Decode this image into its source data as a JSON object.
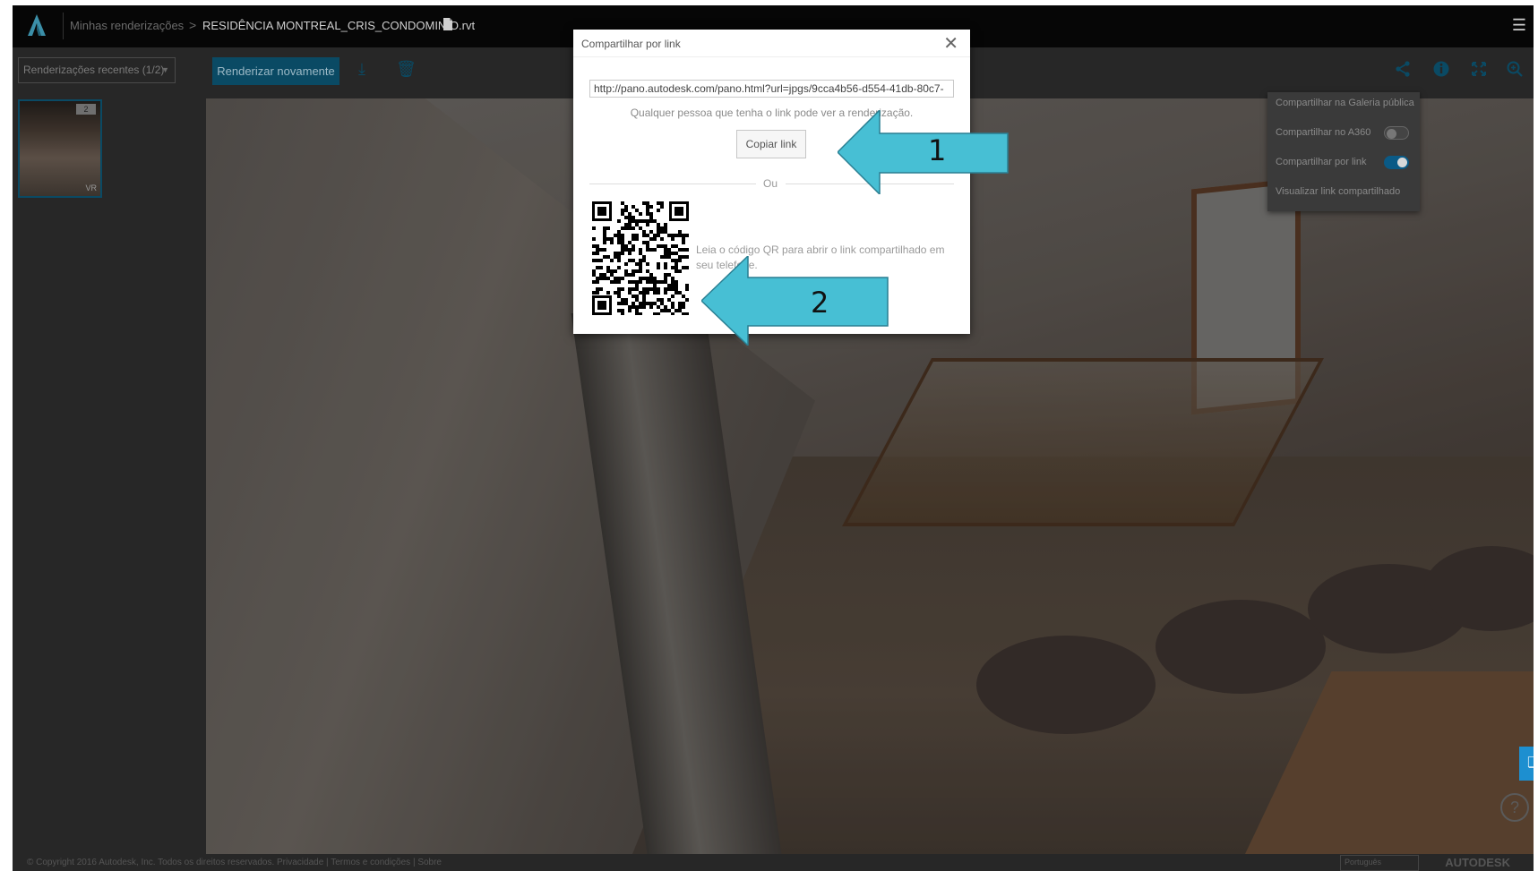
{
  "header": {
    "breadcrumb_root": "Minhas renderizações",
    "breadcrumb_separator": ">",
    "file_name": "RESIDÊNCIA MONTREAL_CRIS_CONDOMINIO.rvt",
    "menu_icon": "hamburger-icon"
  },
  "toolbar": {
    "recent_select": "Renderizações recentes  (1/2)",
    "render_again": "Renderizar novamente",
    "icons": [
      "download-icon",
      "trash-icon",
      "share-icon",
      "info-icon",
      "fullscreen-icon",
      "zoom-icon"
    ]
  },
  "thumbnails": [
    {
      "badge": "2",
      "type_label": "VR"
    }
  ],
  "share_menu": {
    "items": [
      {
        "label": "Compartilhar na Galeria pública"
      },
      {
        "label": "Compartilhar no A360",
        "toggle": "off"
      },
      {
        "label": "Compartilhar por link",
        "toggle": "on"
      },
      {
        "label": "Visualizar link compartilhado"
      }
    ]
  },
  "modal": {
    "title": "Compartilhar por link",
    "url": "http://pano.autodesk.com/pano.html?url=jpgs/9cca4b56-d554-41db-80c7-",
    "hint": "Qualquer pessoa que tenha o link pode ver a renderização.",
    "copy_button": "Copiar link",
    "or": "Ou",
    "qr_text": "Leia o código QR para abrir o link compartilhado em seu telefone."
  },
  "annotations": [
    {
      "label": "1"
    },
    {
      "label": "2"
    }
  ],
  "footer": {
    "copyright": "© Copyright 2016 Autodesk, Inc. Todos os direitos reservados. Privacidade | Termos e condições | Sobre",
    "language": "Português",
    "brand": "AUTODESK"
  },
  "colors": {
    "accent": "#0696d7",
    "annotation_arrow": "#47bfd4"
  }
}
